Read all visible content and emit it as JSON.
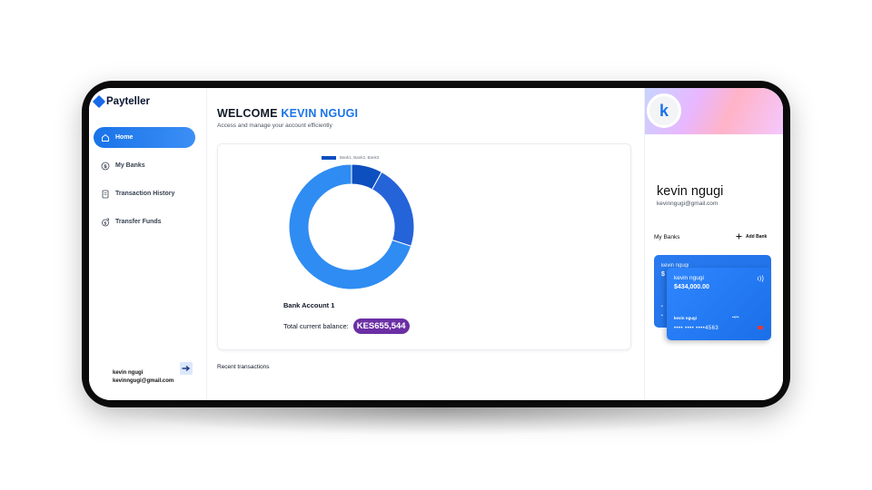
{
  "brand": {
    "name": "Payteller"
  },
  "sidebar": {
    "items": [
      {
        "label": "Home",
        "icon": "home-icon",
        "active": true
      },
      {
        "label": "My Banks",
        "icon": "dollar-icon",
        "active": false
      },
      {
        "label": "Transaction History",
        "icon": "receipt-icon",
        "active": false
      },
      {
        "label": "Transfer Funds",
        "icon": "transfer-icon",
        "active": false
      }
    ],
    "footer": {
      "name": "kevin ngugi",
      "email": "kevinngugi@gmail.com"
    }
  },
  "main": {
    "welcome_prefix": "WELCOME",
    "welcome_name": "KEVIN NGUGI",
    "subtitle": "Access and manage your account efficiently",
    "recent_label": "Recent transactions"
  },
  "chart_data": {
    "type": "pie",
    "legend": "Bank1, Bank2, Bank3",
    "categories": [
      "Bank1",
      "Bank2",
      "Bank3"
    ],
    "values": [
      8,
      22,
      70
    ],
    "colors": [
      "#0d4fbf",
      "#2563d9",
      "#2f8cf2"
    ],
    "account_name": "Bank Account 1",
    "balance_label": "Total current balance:",
    "balance_value": "KES655,544",
    "balance_color": "#6b2fa3"
  },
  "profile": {
    "initial": "k",
    "name": "kevin ngugi",
    "email": "kevinngugi@gmail.com",
    "banks_label": "My Banks",
    "add_bank_label": "Add Bank",
    "back_card": {
      "bank": "kevin ngugi",
      "amount": "$",
      "dots1": "•",
      "dots2": "•"
    },
    "front_card": {
      "bank": "kevin ngugi",
      "amount": "$434,000.00",
      "holder": "kevin ngugi",
      "expiry": "••/••",
      "number": "•••• •••• ••••4563"
    }
  },
  "colors": {
    "accent": "#1a73e8",
    "pill": "#6b2fa3",
    "frame": "#0b0b0b"
  }
}
